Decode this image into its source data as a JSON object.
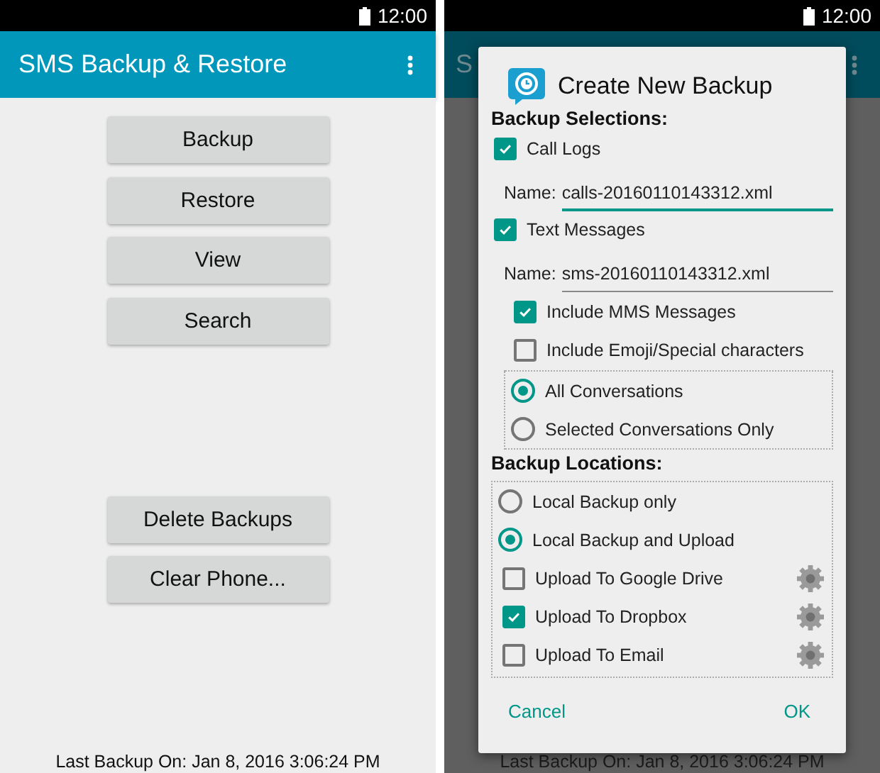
{
  "left_screen": {
    "status_time": "12:00",
    "app_title": "SMS Backup & Restore",
    "main_buttons": [
      "Backup",
      "Restore",
      "View",
      "Search"
    ],
    "lower_buttons": [
      "Delete Backups",
      "Clear Phone..."
    ],
    "footer": "Last Backup On: Jan 8, 2016 3:06:24 PM"
  },
  "right_screen": {
    "status_time": "12:00",
    "app_title": "S",
    "footer": "Last Backup On: Jan 8, 2016 3:06:24 PM",
    "dialog": {
      "title": "Create New Backup",
      "selections_heading": "Backup Selections:",
      "call_logs": {
        "checkbox": {
          "label": "Call Logs",
          "checked": true
        },
        "name_field": {
          "label": "Name:",
          "value": "calls-20160110143312.xml",
          "focused": true
        }
      },
      "text_messages": {
        "checkbox": {
          "label": "Text Messages",
          "checked": true
        },
        "name_field": {
          "label": "Name:",
          "value": "sms-20160110143312.xml",
          "focused": false
        },
        "options": [
          {
            "label": "Include MMS Messages",
            "checked": true
          },
          {
            "label": "Include Emoji/Special characters",
            "checked": false
          }
        ],
        "conversations": [
          {
            "label": "All Conversations",
            "selected": true
          },
          {
            "label": "Selected Conversations Only",
            "selected": false
          }
        ]
      },
      "locations_heading": "Backup Locations:",
      "location_choices": [
        {
          "label": "Local Backup only",
          "selected": false
        },
        {
          "label": "Local Backup and Upload",
          "selected": true
        }
      ],
      "uploads": [
        {
          "label": "Upload To Google Drive",
          "checked": false
        },
        {
          "label": "Upload To Dropbox",
          "checked": true
        },
        {
          "label": "Upload To Email",
          "checked": false
        }
      ],
      "actions": [
        "Cancel",
        "OK"
      ]
    }
  }
}
